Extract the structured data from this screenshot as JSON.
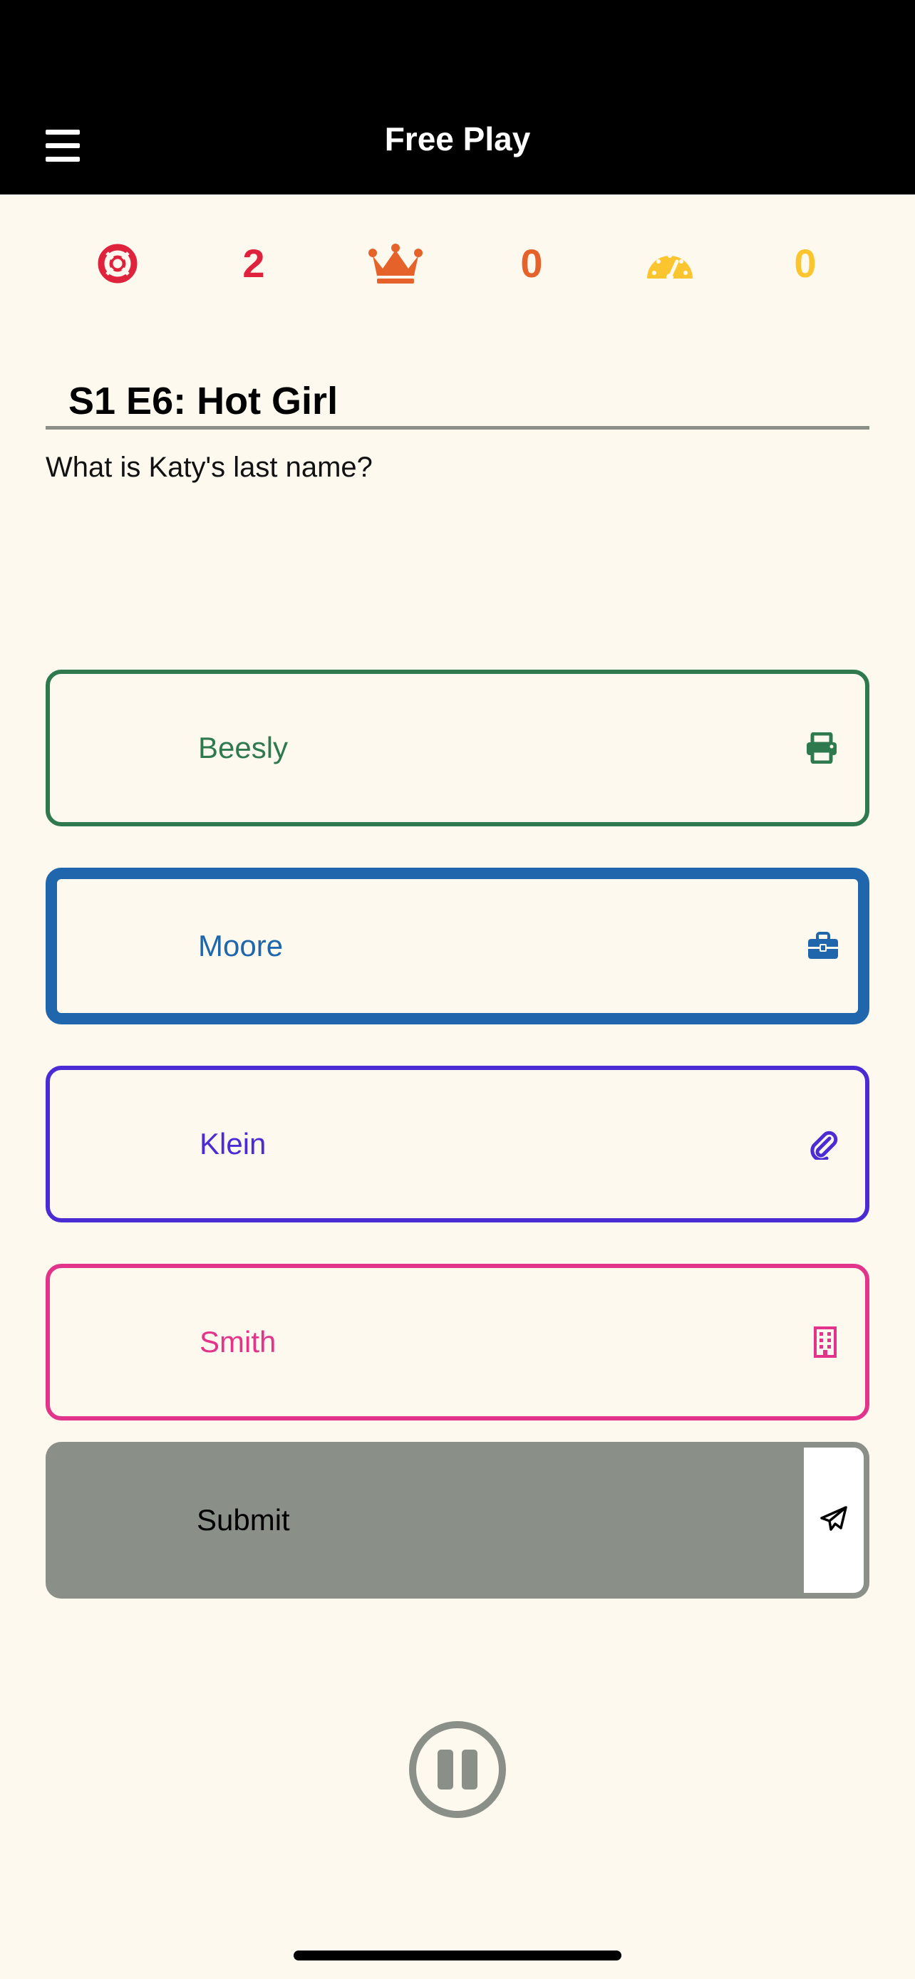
{
  "nav": {
    "title": "Free Play",
    "menu_icon": "hamburger-menu-icon"
  },
  "stats": [
    {
      "icon": "life-ring-icon",
      "value": "2",
      "color": "#e0233c"
    },
    {
      "icon": "crown-icon",
      "value": "0",
      "color": "#e5632a"
    },
    {
      "icon": "speedometer-icon",
      "value": "0",
      "color": "#fbc530"
    }
  ],
  "question": {
    "episode": "S1 E6: Hot Girl",
    "text": "What is Katy's last name?"
  },
  "answers": [
    {
      "label": "Beesly",
      "icon": "printer-icon",
      "color": "#2e7a4e"
    },
    {
      "label": "Moore",
      "icon": "briefcase-icon",
      "color": "#2066ad"
    },
    {
      "label": "Klein",
      "icon": "paperclip-icon",
      "color": "#4a2bd4"
    },
    {
      "label": "Smith",
      "icon": "building-icon",
      "color": "#e2348b"
    }
  ],
  "submit": {
    "label": "Submit",
    "icon": "paper-plane-icon",
    "color": "#8a8f88"
  },
  "controls": {
    "pause_icon": "pause-icon"
  }
}
